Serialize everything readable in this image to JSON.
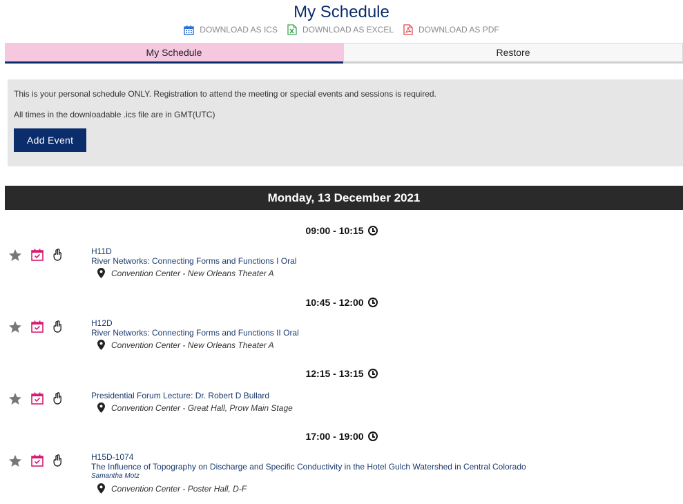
{
  "page": {
    "title": "My Schedule",
    "downloads": [
      {
        "label": "DOWNLOAD AS ICS",
        "icon": "calendar-icon",
        "color": "#2a6fd6"
      },
      {
        "label": "DOWNLOAD AS EXCEL",
        "icon": "excel-icon",
        "color": "#3aa655"
      },
      {
        "label": "DOWNLOAD AS PDF",
        "icon": "pdf-icon",
        "color": "#e04a4a"
      }
    ]
  },
  "tabs": [
    {
      "label": "My Schedule",
      "active": true
    },
    {
      "label": "Restore",
      "active": false
    }
  ],
  "notice": {
    "line1": "This is your personal schedule ONLY. Registration to attend the meeting or special events and sessions is required.",
    "line2": "All times in the downloadable .ics file are in GMT(UTC)",
    "add_button": "Add Event"
  },
  "day": {
    "label": "Monday, 13 December 2021",
    "slots": [
      {
        "time": "09:00 - 10:15",
        "code": "H11D",
        "title": "River Networks: Connecting Forms and Functions I Oral",
        "author": "",
        "location": "Convention Center - New Orleans Theater A"
      },
      {
        "time": "10:45 - 12:00",
        "code": "H12D",
        "title": "River Networks: Connecting Forms and Functions II Oral",
        "author": "",
        "location": "Convention Center - New Orleans Theater A"
      },
      {
        "time": "12:15 - 13:15",
        "code": "",
        "title": "Presidential Forum Lecture: Dr. Robert D Bullard",
        "author": "",
        "location": "Convention Center - Great Hall, Prow Main Stage"
      },
      {
        "time": "17:00 - 19:00",
        "code": "H15D-1074",
        "title": "The Influence of Topography on Discharge and Specific Conductivity in the Hotel Gulch Watershed in Central Colorado",
        "author": "Samantha Motz",
        "location": "Convention Center - Poster Hall, D-F"
      }
    ]
  },
  "colors": {
    "accent": "#0b2d6b",
    "tab_active": "#f6c8e0",
    "calendar_check": "#d81b72",
    "star": "#777777"
  }
}
